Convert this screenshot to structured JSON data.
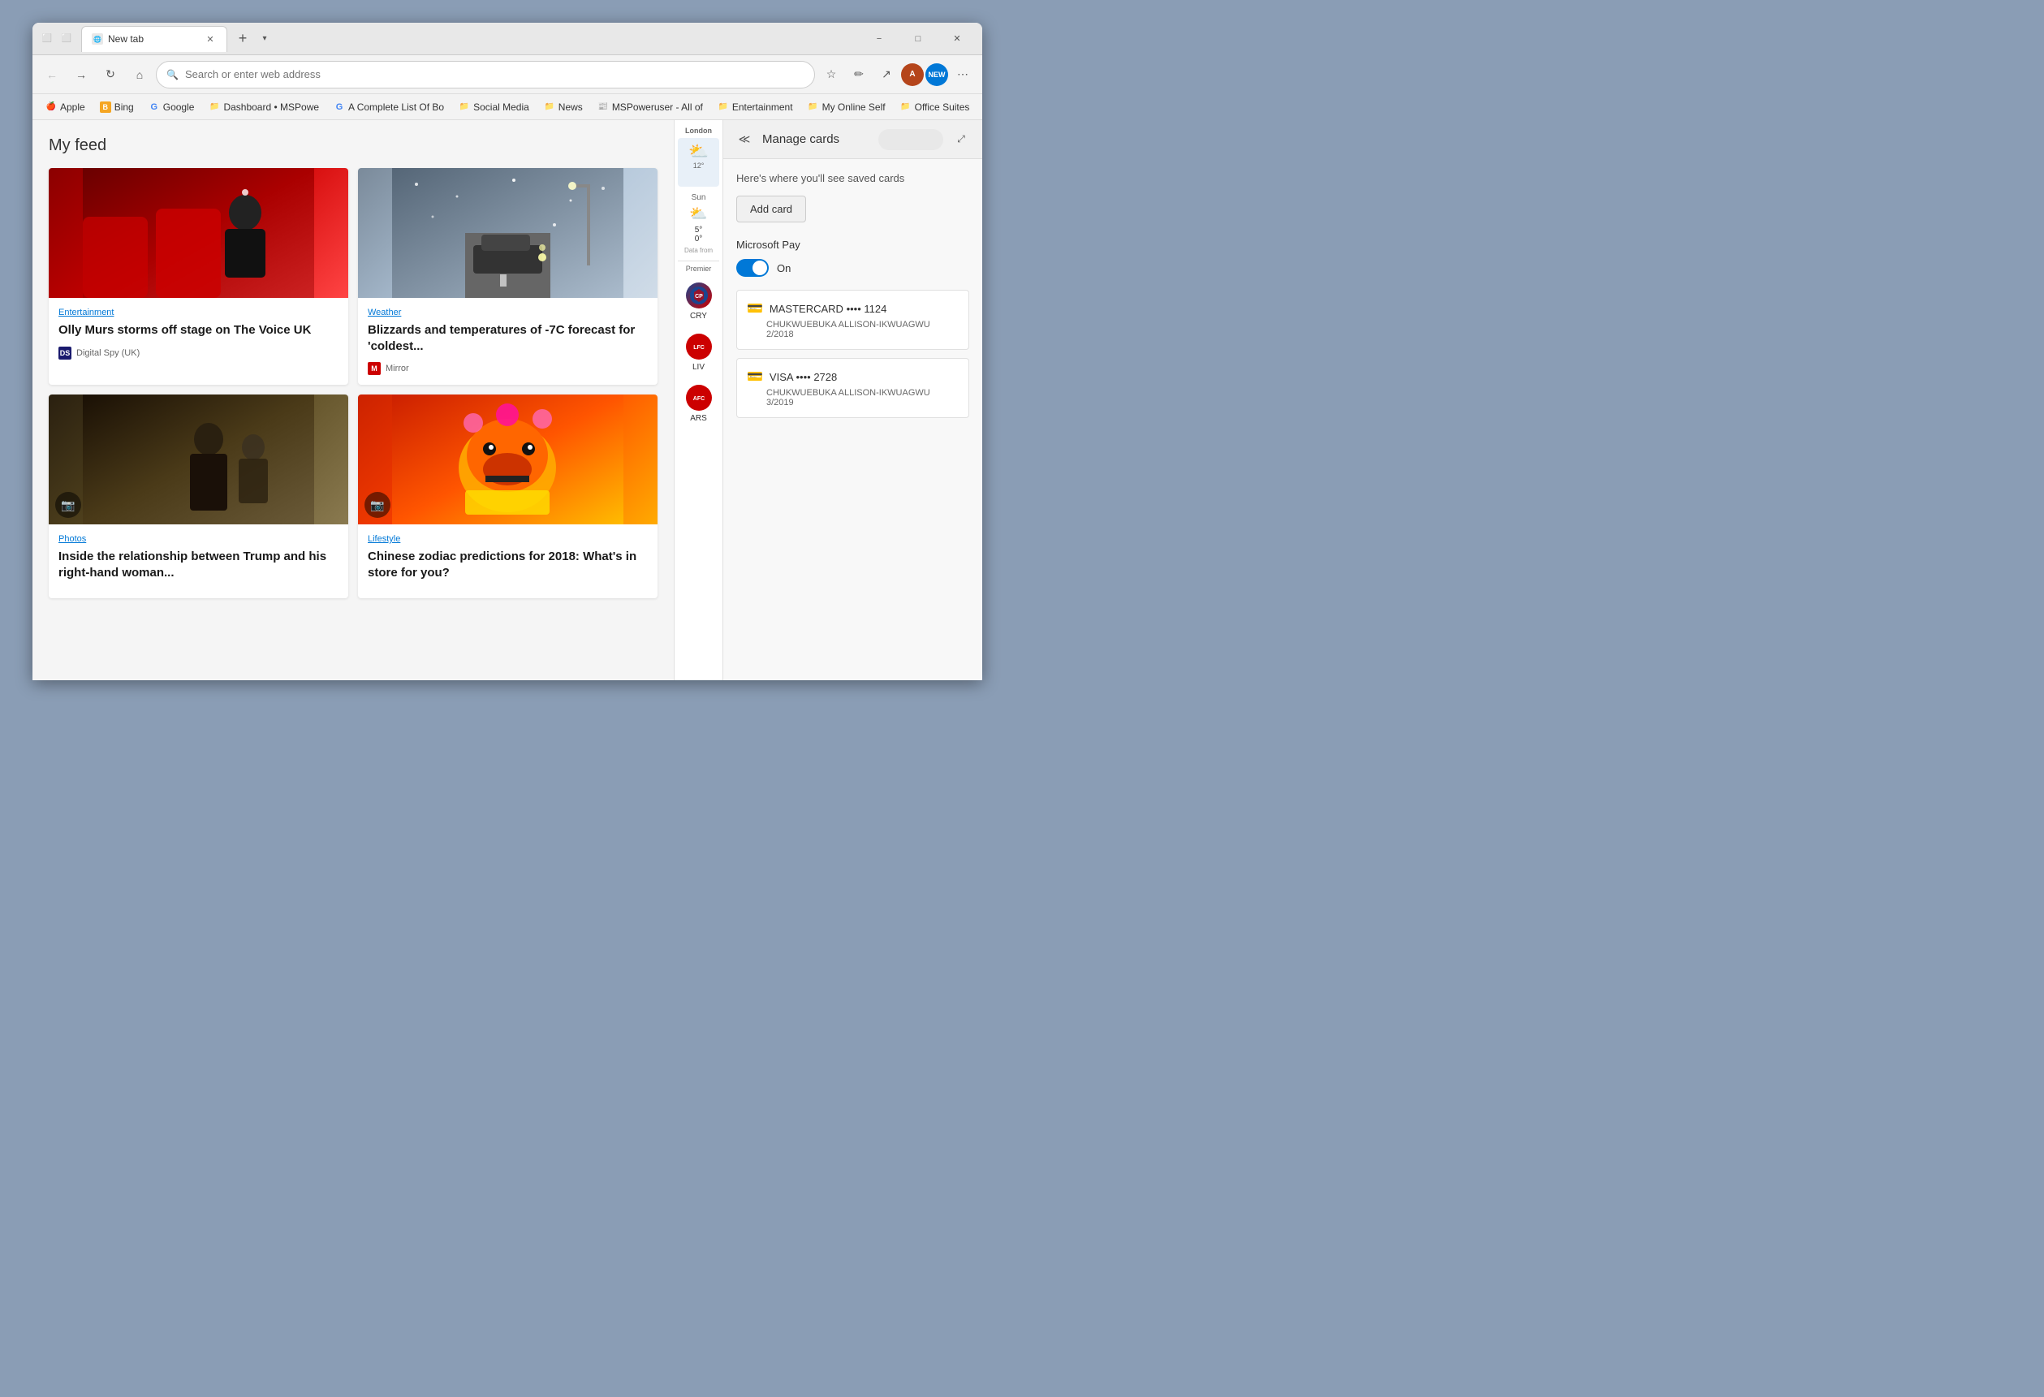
{
  "browser": {
    "tab_title": "New tab",
    "tab_icon": "🌐",
    "address_placeholder": "Search or enter web address",
    "address_value": ""
  },
  "bookmarks": [
    {
      "id": "apple",
      "label": "Apple",
      "icon": "🍎",
      "type": "site"
    },
    {
      "id": "bing",
      "label": "Bing",
      "icon": "B",
      "type": "site",
      "color": "#f5a623"
    },
    {
      "id": "google",
      "label": "Google",
      "icon": "G",
      "type": "site",
      "color": "#4285f4"
    },
    {
      "id": "dashboard",
      "label": "Dashboard • MSPowe",
      "icon": "📁",
      "type": "folder"
    },
    {
      "id": "completelist",
      "label": "A Complete List Of Bo",
      "icon": "G",
      "type": "site",
      "color": "#4285f4"
    },
    {
      "id": "socialmedia",
      "label": "Social Media",
      "icon": "📁",
      "type": "folder"
    },
    {
      "id": "news",
      "label": "News",
      "icon": "📁",
      "type": "folder"
    },
    {
      "id": "mspoweruser",
      "label": "MSPoweruser - All of",
      "icon": "📰",
      "type": "site"
    },
    {
      "id": "entertainment",
      "label": "Entertainment",
      "icon": "📁",
      "type": "folder"
    },
    {
      "id": "myonlineself",
      "label": "My Online Self",
      "icon": "📁",
      "type": "folder"
    },
    {
      "id": "officesuites",
      "label": "Office Suites",
      "icon": "📁",
      "type": "folder"
    }
  ],
  "feed": {
    "title": "My feed",
    "cards": [
      {
        "id": "card1",
        "category": "Entertainment",
        "title": "Olly Murs storms off stage on The Voice UK",
        "source": "Digital Spy (UK)",
        "source_abbr": "DS",
        "source_color": "#1a1a6e",
        "image_type": "entertainment",
        "has_camera": false
      },
      {
        "id": "card2",
        "category": "Weather",
        "title": "Blizzards and temperatures of -7C forecast for 'coldest...",
        "source": "Mirror",
        "source_abbr": "M",
        "source_color": "#cc0000",
        "image_type": "weather",
        "has_camera": false
      },
      {
        "id": "card3",
        "category": "Photos",
        "title": "Inside the relationship between Trump and his right-hand woman...",
        "source": "",
        "source_abbr": "",
        "source_color": "",
        "image_type": "photos",
        "has_camera": true
      },
      {
        "id": "card4",
        "category": "Lifestyle",
        "title": "Chinese zodiac predictions for 2018: What's in store for you?",
        "source": "",
        "source_abbr": "",
        "source_color": "",
        "image_type": "lifestyle",
        "has_camera": true
      }
    ]
  },
  "weather": {
    "location": "London",
    "days": [
      {
        "label": "Sun",
        "icon": "⛅",
        "high": "5°",
        "low": "0°"
      }
    ]
  },
  "sports": {
    "section_label": "Premier",
    "teams": [
      {
        "abbr": "CRY",
        "color": "#1b458f",
        "color2": "#cc0000"
      },
      {
        "abbr": "LIV",
        "color": "#cc0000"
      },
      {
        "abbr": "ARS",
        "color": "#cc0000",
        "color2": "#ffffff"
      }
    ]
  },
  "manage_cards": {
    "title": "Manage cards",
    "subtitle": "Here's where you'll see saved cards",
    "add_card_label": "Add card",
    "microsoft_pay_label": "Microsoft Pay",
    "toggle_state": "On",
    "cards": [
      {
        "id": "mc1",
        "type": "MASTERCARD",
        "dots": "••••",
        "last4": "1124",
        "holder": "CHUKWUEBUKA ALLISON-IKWUAGWU",
        "expiry": "2/2018"
      },
      {
        "id": "mc2",
        "type": "VISA",
        "dots": "••••",
        "last4": "2728",
        "holder": "CHUKWUEBUKA ALLISON-IKWUAGWU",
        "expiry": "3/2019"
      }
    ]
  },
  "window": {
    "minimize_label": "−",
    "maximize_label": "□",
    "close_label": "✕"
  }
}
